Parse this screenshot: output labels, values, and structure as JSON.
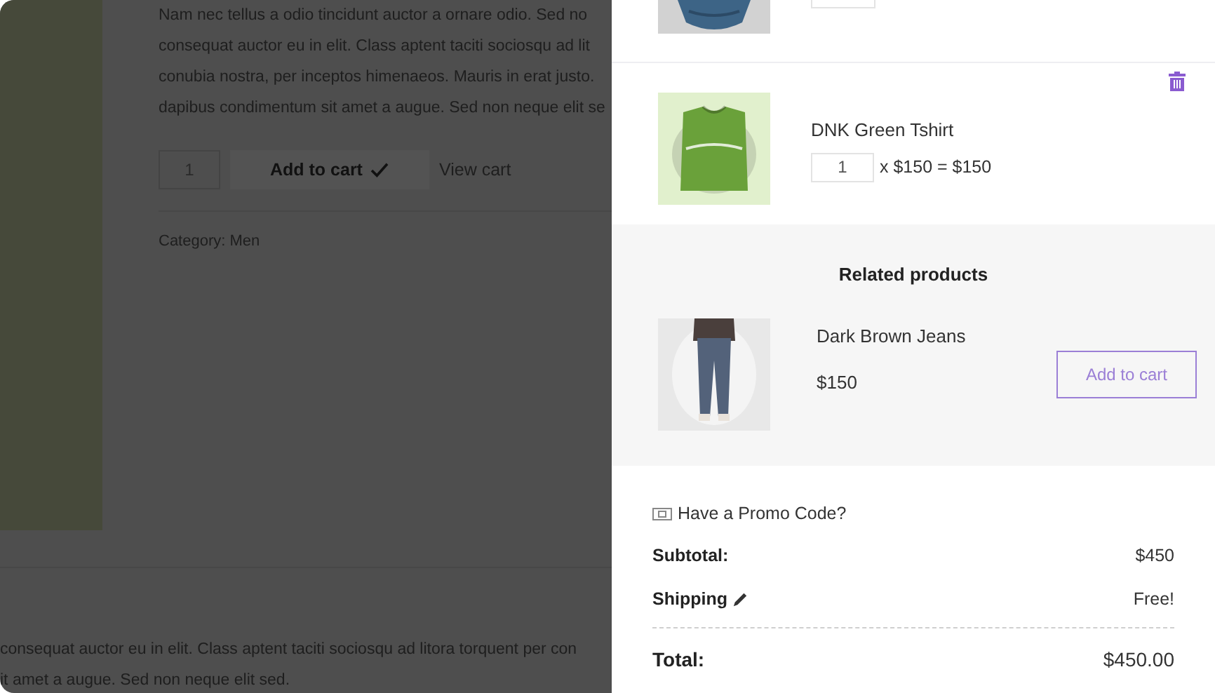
{
  "background_page": {
    "description_lines": [
      "Nam nec tellus a odio tincidunt auctor a ornare odio. Sed no",
      "consequat auctor eu in elit. Class aptent taciti sociosqu ad lit",
      "conubia nostra, per inceptos himenaeos. Mauris in erat justo.",
      "dapibus condimentum sit amet a augue. Sed non neque elit se"
    ],
    "quantity": "1",
    "add_to_cart": "Add to cart",
    "added": true,
    "view_cart": "View cart",
    "category": "Category: Men",
    "footer_lines": [
      "consequat auctor eu in elit. Class aptent taciti sociosqu ad litora torquent per con",
      "it amet a augue. Sed non neque elit sed."
    ]
  },
  "cart": {
    "items": [
      {
        "kind": "cut_off"
      },
      {
        "kind": "full",
        "name": "DNK Green Tshirt",
        "quantity": "1",
        "price_line": "x $150 = $150"
      }
    ]
  },
  "related": {
    "title": "Related products",
    "products": [
      {
        "name": "Dark Brown Jeans",
        "price": "$150",
        "button": "Add to cart"
      }
    ]
  },
  "totals": {
    "promo": "Have a Promo Code?",
    "rows": [
      {
        "label": "Subtotal:",
        "value": "$450",
        "editable": false
      },
      {
        "label": "Shipping",
        "value": "Free!",
        "editable": true
      }
    ],
    "total_label": "Total:",
    "total_value": "$450.00"
  }
}
